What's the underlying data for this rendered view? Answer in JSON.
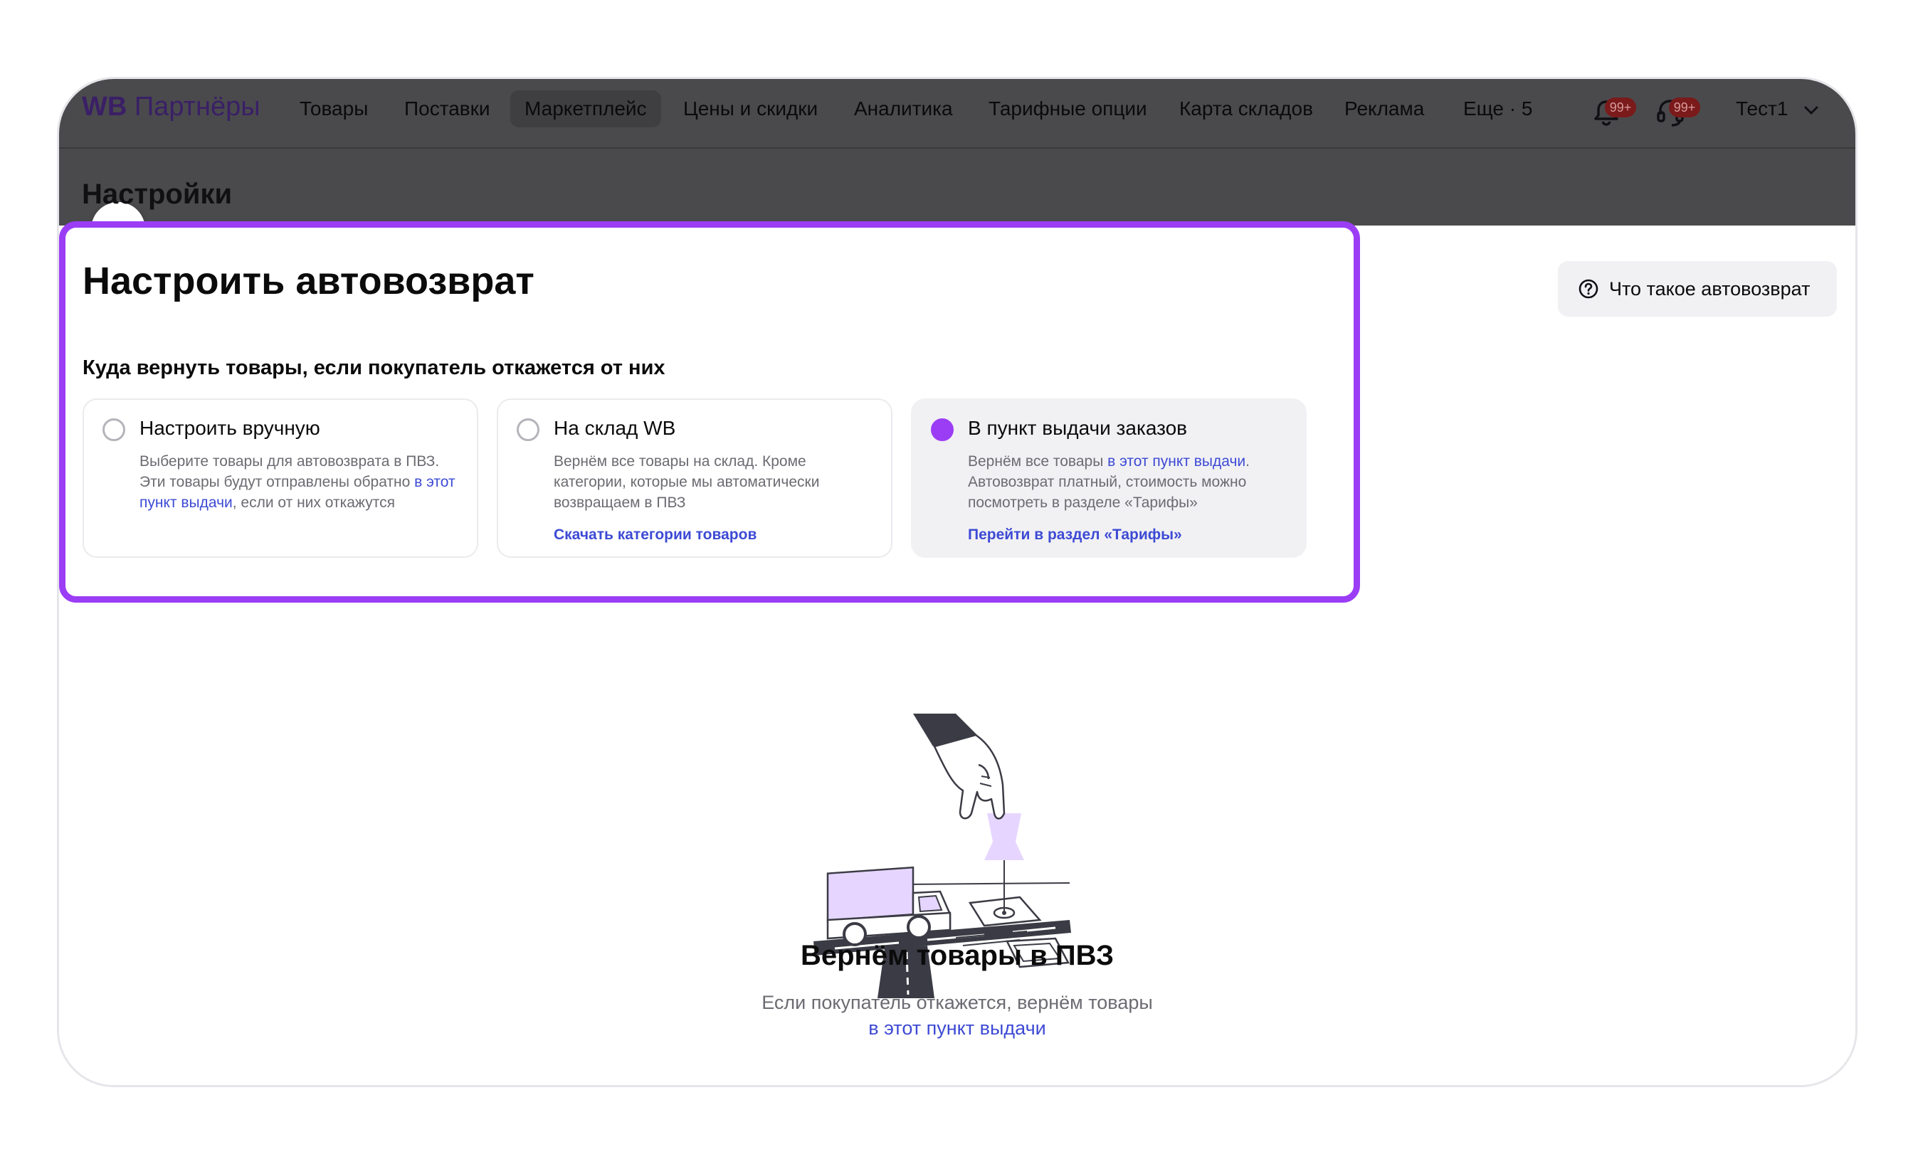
{
  "nav": {
    "logo_brand": "WB",
    "logo_text": " Партнёры",
    "items": [
      {
        "label": "Товары"
      },
      {
        "label": "Поставки"
      },
      {
        "label": "Маркетплейс"
      },
      {
        "label": "Цены и скидки"
      },
      {
        "label": "Аналитика"
      },
      {
        "label": "Тарифные опции"
      },
      {
        "label": "Карта складов"
      },
      {
        "label": "Реклама"
      },
      {
        "label": "Еще · 5"
      }
    ],
    "active_item": "Маркетплейс",
    "notifications_badge": "99+",
    "support_badge": "99+",
    "user_name": "Тест1"
  },
  "page": {
    "title": "Настройки"
  },
  "autoreturn": {
    "title": "Настроить автовозврат",
    "question": "Куда вернуть товары, если покупатель откажется от них",
    "help_button": "Что такое автовозврат",
    "options": [
      {
        "title": "Настроить вручную",
        "desc_before": "Выберите товары для автовозврата в ПВЗ. Эти товары будут отправлены обратно ",
        "desc_link": "в этот пункт выдачи",
        "desc_after": ", если от них откажутся",
        "selected": false
      },
      {
        "title": "На склад WB",
        "desc": "Вернём все товары на склад. Кроме категории, которые мы автоматически возвращаем в ПВЗ",
        "link": "Скачать категории товаров",
        "selected": false
      },
      {
        "title": "В пункт выдачи заказов",
        "desc_before": "Вернём все товары ",
        "desc_link": "в этот пункт выдачи",
        "desc_after": ". Автовозврат платный, стоимость можно посмотреть в разделе «Тарифы»",
        "link": "Перейти в раздел «Тарифы»",
        "selected": true
      }
    ]
  },
  "result": {
    "title": "Вернём товары в ПВЗ",
    "desc_before": "Если покупатель откажется, вернём товары ",
    "desc_link": "в этот пункт выдачи"
  },
  "colors": {
    "accent": "#9b3df5",
    "link": "#3d4ad4",
    "overlay": "#4a4a4d",
    "badge": "#7a1a1a"
  },
  "icons": [
    "double-chevron-down-icon",
    "bell-icon",
    "headset-icon",
    "chevron-down-icon",
    "question-circle-icon"
  ]
}
